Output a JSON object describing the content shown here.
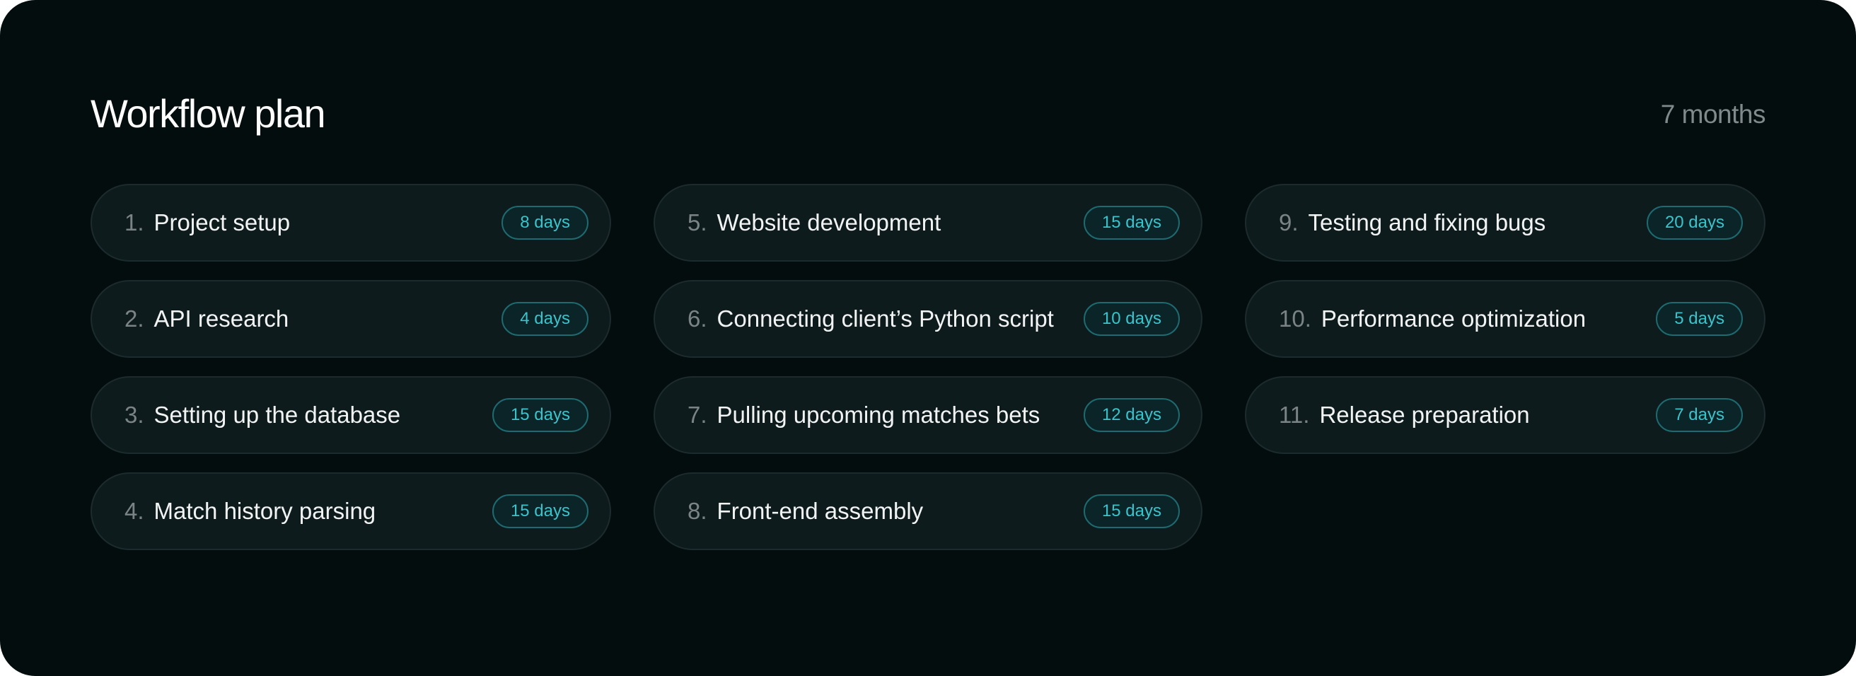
{
  "header": {
    "title": "Workflow plan",
    "duration": "7 months"
  },
  "colors": {
    "background": "#040d0e",
    "item_background": "#0e1b1d",
    "badge_text": "#3bc3cc",
    "badge_border": "#1d6a70",
    "muted_text": "#7a8486"
  },
  "steps": [
    {
      "number": "1.",
      "label": "Project setup",
      "duration": "8 days"
    },
    {
      "number": "2.",
      "label": "API research",
      "duration": "4 days"
    },
    {
      "number": "3.",
      "label": "Setting up the database",
      "duration": "15 days"
    },
    {
      "number": "4.",
      "label": "Match history parsing",
      "duration": "15 days"
    },
    {
      "number": "5.",
      "label": "Website development",
      "duration": "15 days"
    },
    {
      "number": "6.",
      "label": "Connecting client’s Python script",
      "duration": "10 days"
    },
    {
      "number": "7.",
      "label": "Pulling upcoming matches bets",
      "duration": "12 days"
    },
    {
      "number": "8.",
      "label": "Front-end assembly",
      "duration": "15 days"
    },
    {
      "number": "9.",
      "label": "Testing and fixing bugs",
      "duration": "20 days"
    },
    {
      "number": "10.",
      "label": "Performance optimization",
      "duration": "5 days"
    },
    {
      "number": "11.",
      "label": "Release preparation",
      "duration": "7 days"
    }
  ]
}
